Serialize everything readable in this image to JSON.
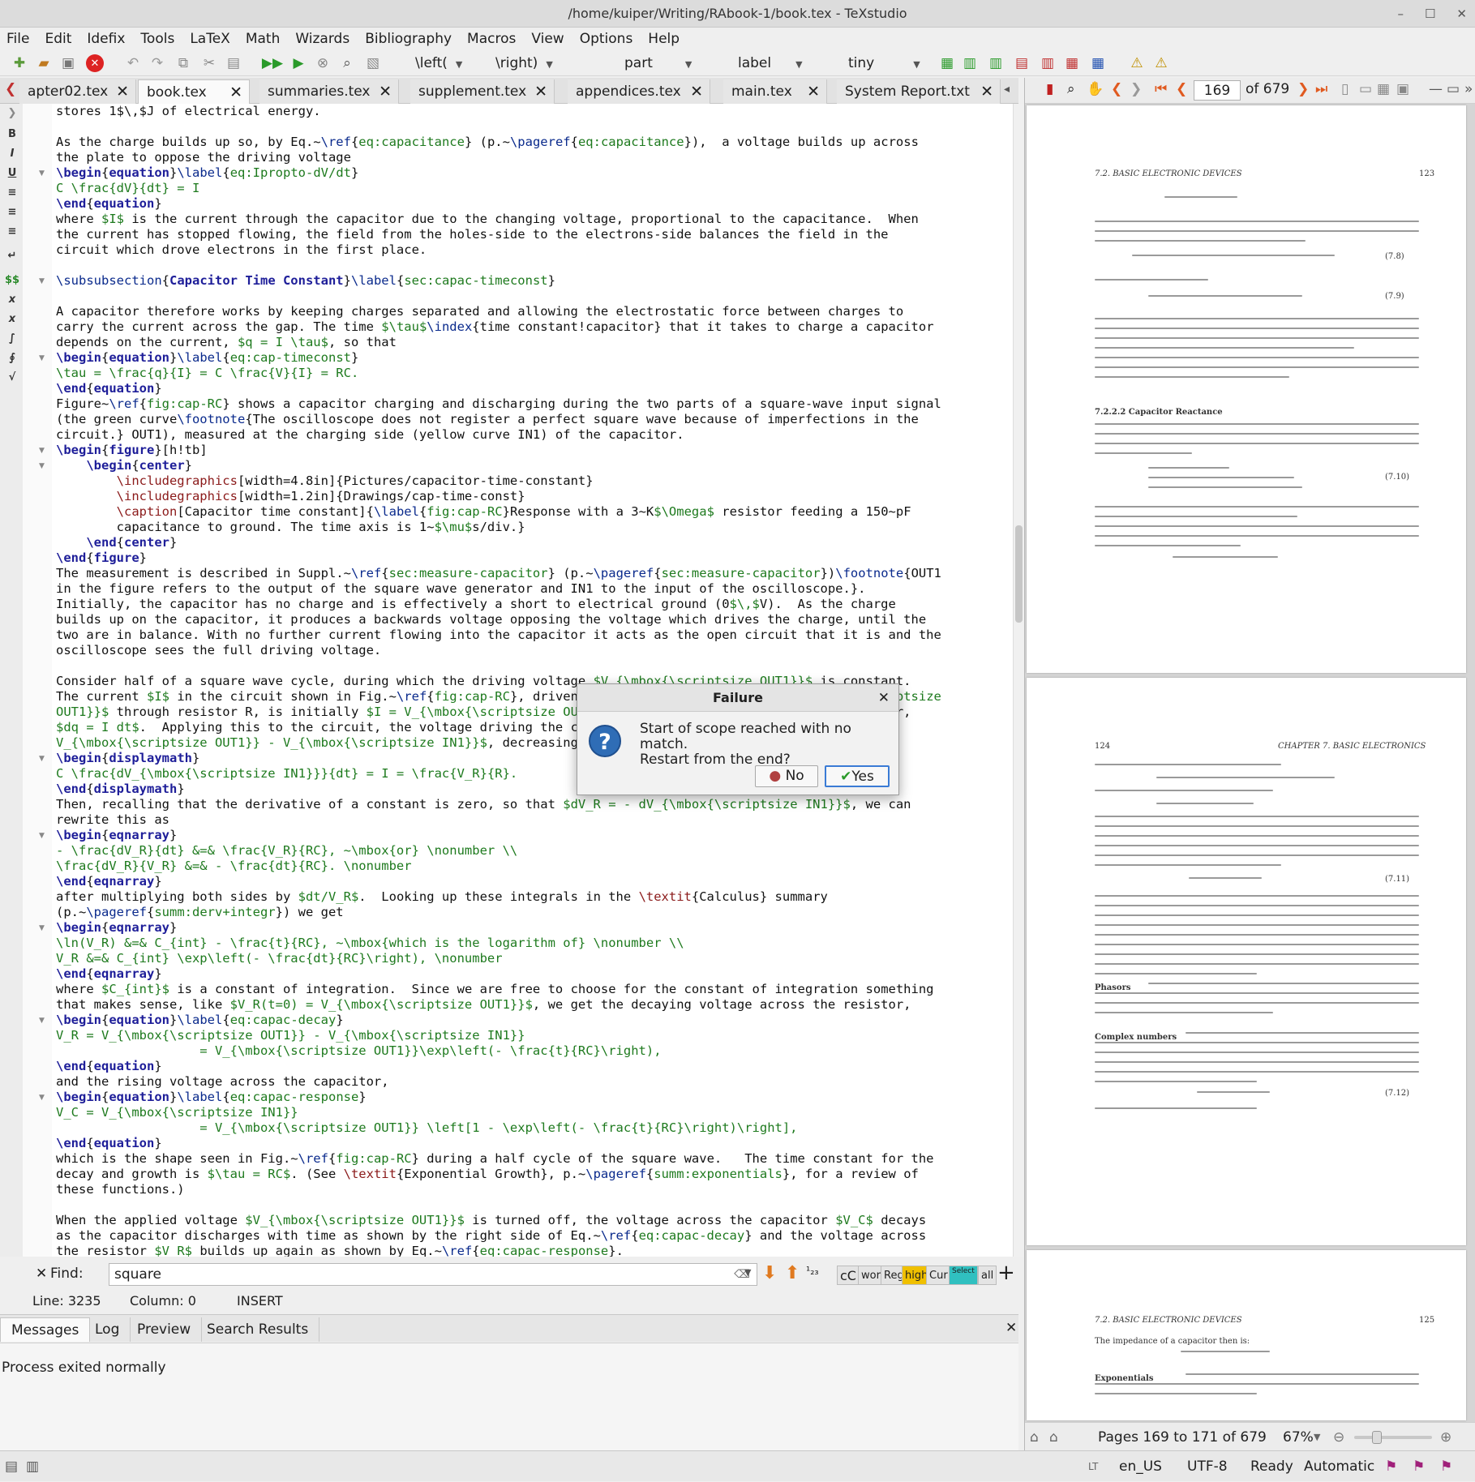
{
  "window": {
    "title": "/home/kuiper/Writing/RAbook-1/book.tex - TeXstudio",
    "controls": [
      "–",
      "☐",
      "✕"
    ]
  },
  "menu": [
    "File",
    "Edit",
    "Idefix",
    "Tools",
    "LaTeX",
    "Math",
    "Wizards",
    "Bibliography",
    "Macros",
    "View",
    "Options",
    "Help"
  ],
  "toolbar": {
    "left": "\\left(",
    "right": "\\right)",
    "part": "part",
    "label": "label",
    "size": "tiny"
  },
  "tabs": [
    {
      "label": "apter02.tex",
      "active": false
    },
    {
      "label": "book.tex",
      "active": true
    },
    {
      "label": "summaries.tex",
      "active": false
    },
    {
      "label": "supplement.tex",
      "active": false
    },
    {
      "label": "appendices.tex",
      "active": false
    },
    {
      "label": "main.tex",
      "active": false
    },
    {
      "label": "System Report.txt",
      "active": false
    }
  ],
  "editor_lines": [
    [
      [
        "t",
        "stores 1$\\,$J of electrical energy."
      ]
    ],
    [
      [
        "t",
        ""
      ]
    ],
    [
      [
        "t",
        "As the charge builds up so, by Eq.~"
      ],
      [
        "b",
        "\\ref"
      ],
      [
        "t",
        "{"
      ],
      [
        "g",
        "eq:capacitance"
      ],
      [
        "t",
        "} (p.~"
      ],
      [
        "b",
        "\\pageref"
      ],
      [
        "t",
        "{"
      ],
      [
        "g",
        "eq:capacitance"
      ],
      [
        "t",
        "}),  a voltage builds up across"
      ]
    ],
    [
      [
        "t",
        "the plate to oppose the driving voltage"
      ]
    ],
    [
      [
        "e",
        "\\begin"
      ],
      [
        "t",
        "{"
      ],
      [
        "e",
        "equation"
      ],
      [
        "t",
        "}"
      ],
      [
        "b",
        "\\label"
      ],
      [
        "t",
        "{"
      ],
      [
        "g",
        "eq:Ipropto-dV/dt"
      ],
      [
        "t",
        "}"
      ]
    ],
    [
      [
        "m",
        "C \\frac{dV}{dt} = I"
      ]
    ],
    [
      [
        "e",
        "\\end"
      ],
      [
        "t",
        "{"
      ],
      [
        "e",
        "equation"
      ],
      [
        "t",
        "}"
      ]
    ],
    [
      [
        "t",
        "where "
      ],
      [
        "m",
        "$I$"
      ],
      [
        "t",
        " is the current through the capacitor due to the changing voltage, proportional to the capacitance.  When"
      ]
    ],
    [
      [
        "t",
        "the current has stopped flowing, the field from the holes-side to the electrons-side balances the field in the"
      ]
    ],
    [
      [
        "t",
        "circuit which drove electrons in the first place."
      ]
    ],
    [
      [
        "t",
        ""
      ]
    ],
    [
      [
        "b",
        "\\subsubsection"
      ],
      [
        "t",
        "{"
      ],
      [
        "k",
        "Capacitor Time Constant"
      ],
      [
        "t",
        "}"
      ],
      [
        "b",
        "\\label"
      ],
      [
        "t",
        "{"
      ],
      [
        "g",
        "sec:capac-timeconst"
      ],
      [
        "t",
        "}"
      ]
    ],
    [
      [
        "t",
        ""
      ]
    ],
    [
      [
        "t",
        "A capacitor therefore works by keeping charges separated and allowing the electrostatic force between charges to"
      ]
    ],
    [
      [
        "t",
        "carry the current across the gap. The time "
      ],
      [
        "m",
        "$\\tau$"
      ],
      [
        "b",
        "\\index"
      ],
      [
        "t",
        "{time constant!capacitor} that it takes to charge a capacitor"
      ]
    ],
    [
      [
        "t",
        "depends on the current, "
      ],
      [
        "m",
        "$q = I \\tau$"
      ],
      [
        "t",
        ", so that"
      ]
    ],
    [
      [
        "e",
        "\\begin"
      ],
      [
        "t",
        "{"
      ],
      [
        "e",
        "equation"
      ],
      [
        "t",
        "}"
      ],
      [
        "b",
        "\\label"
      ],
      [
        "t",
        "{"
      ],
      [
        "g",
        "eq:cap-timeconst"
      ],
      [
        "t",
        "}"
      ]
    ],
    [
      [
        "m",
        "\\tau = \\frac{q}{I} = C \\frac{V}{I} = RC."
      ]
    ],
    [
      [
        "e",
        "\\end"
      ],
      [
        "t",
        "{"
      ],
      [
        "e",
        "equation"
      ],
      [
        "t",
        "}"
      ]
    ],
    [
      [
        "t",
        "Figure~"
      ],
      [
        "b",
        "\\ref"
      ],
      [
        "t",
        "{"
      ],
      [
        "g",
        "fig:cap-RC"
      ],
      [
        "t",
        "} shows a capacitor charging and discharging during the two parts of a square-wave input signal"
      ]
    ],
    [
      [
        "t",
        "(the green curve"
      ],
      [
        "b",
        "\\footnote"
      ],
      [
        "t",
        "{The oscilloscope does not register a perfect square wave because of imperfections in the"
      ]
    ],
    [
      [
        "t",
        "circuit.} OUT1), measured at the charging side (yellow curve IN1) of the capacitor."
      ]
    ],
    [
      [
        "e",
        "\\begin"
      ],
      [
        "t",
        "{"
      ],
      [
        "e",
        "figure"
      ],
      [
        "t",
        "}[h!tb]"
      ]
    ],
    [
      [
        "t",
        "    "
      ],
      [
        "e",
        "\\begin"
      ],
      [
        "t",
        "{"
      ],
      [
        "e",
        "center"
      ],
      [
        "t",
        "}"
      ]
    ],
    [
      [
        "t",
        "        "
      ],
      [
        "a",
        "\\includegraphics"
      ],
      [
        "t",
        "[width=4.8in]{Pictures/capacitor-time-constant}"
      ]
    ],
    [
      [
        "t",
        "        "
      ],
      [
        "a",
        "\\includegraphics"
      ],
      [
        "t",
        "[width=1.2in]{Drawings/cap-time-const}"
      ]
    ],
    [
      [
        "t",
        "        "
      ],
      [
        "a",
        "\\caption"
      ],
      [
        "t",
        "[Capacitor time constant]{"
      ],
      [
        "b",
        "\\label"
      ],
      [
        "t",
        "{"
      ],
      [
        "g",
        "fig:cap-RC"
      ],
      [
        "t",
        "}Response with a 3~K"
      ],
      [
        "m",
        "$\\Omega$"
      ],
      [
        "t",
        " resistor feeding a 150~pF"
      ]
    ],
    [
      [
        "t",
        "        capacitance to ground. The time axis is 1~"
      ],
      [
        "m",
        "$\\mu$"
      ],
      [
        "t",
        "s/div.}"
      ]
    ],
    [
      [
        "t",
        "    "
      ],
      [
        "e",
        "\\end"
      ],
      [
        "t",
        "{"
      ],
      [
        "e",
        "center"
      ],
      [
        "t",
        "}"
      ]
    ],
    [
      [
        "e",
        "\\end"
      ],
      [
        "t",
        "{"
      ],
      [
        "e",
        "figure"
      ],
      [
        "t",
        "}"
      ]
    ],
    [
      [
        "t",
        "The measurement is described in Suppl.~"
      ],
      [
        "b",
        "\\ref"
      ],
      [
        "t",
        "{"
      ],
      [
        "g",
        "sec:measure-capacitor"
      ],
      [
        "t",
        "} (p.~"
      ],
      [
        "b",
        "\\pageref"
      ],
      [
        "t",
        "{"
      ],
      [
        "g",
        "sec:measure-capacitor"
      ],
      [
        "t",
        "})"
      ],
      [
        "b",
        "\\footnote"
      ],
      [
        "t",
        "{OUT1"
      ]
    ],
    [
      [
        "t",
        "in the figure refers to the output of the square wave generator and IN1 to the input of the oscilloscope.}."
      ]
    ],
    [
      [
        "t",
        "Initially, the capacitor has no charge and is effectively a short to electrical ground (0"
      ],
      [
        "m",
        "$\\,$"
      ],
      [
        "t",
        "V).  As the charge"
      ]
    ],
    [
      [
        "t",
        "builds up on the capacitor, it produces a backwards voltage opposing the voltage which drives the charge, until the"
      ]
    ],
    [
      [
        "t",
        "two are in balance. With no further current flowing into the capacitor it acts as the open circuit that it is and the"
      ]
    ],
    [
      [
        "t",
        "oscilloscope sees the full driving voltage."
      ]
    ],
    [
      [
        "t",
        ""
      ]
    ],
    [
      [
        "t",
        "Consider half of a square wave cycle, during which the driving voltage "
      ],
      [
        "m",
        "$V_{\\mbox{\\scriptsize OUT1}}$"
      ],
      [
        "t",
        " is constant."
      ]
    ],
    [
      [
        "t",
        "The current "
      ],
      [
        "m",
        "$I$"
      ],
      [
        "t",
        " in the circuit shown in Fig.~"
      ],
      [
        "b",
        "\\ref"
      ],
      [
        "t",
        "{"
      ],
      [
        "g",
        "fig:cap-RC"
      ],
      [
        "t",
        "}, driven by the voltage difference "
      ],
      [
        "m",
        "$V_{\\mbox{\\scriptsize"
      ]
    ],
    [
      [
        "m",
        "OUT1}}$"
      ],
      [
        "t",
        " through resistor R, is initially "
      ],
      [
        "m",
        "$I = V_{\\mbox{\\scriptsize OUT1}}/R$"
      ],
      [
        "t",
        ". As charge flows into the capacitor,"
      ]
    ],
    [
      [
        "m",
        "$dq = I dt$"
      ],
      [
        "t",
        ".  Applying this to the circuit, the voltage driving the current is the difference"
      ]
    ],
    [
      [
        "m",
        "V_{\\mbox{\\scriptsize OUT1}} - V_{\\mbox{\\scriptsize IN1}}$"
      ],
      [
        "t",
        ", decreasing with time."
      ]
    ],
    [
      [
        "e",
        "\\begin"
      ],
      [
        "t",
        "{"
      ],
      [
        "e",
        "displaymath"
      ],
      [
        "t",
        "}"
      ]
    ],
    [
      [
        "m",
        "C \\frac{dV_{\\mbox{\\scriptsize IN1}}}{dt} = I = \\frac{V_R}{R}."
      ]
    ],
    [
      [
        "e",
        "\\end"
      ],
      [
        "t",
        "{"
      ],
      [
        "e",
        "displaymath"
      ],
      [
        "t",
        "}"
      ]
    ],
    [
      [
        "t",
        "Then, recalling that the derivative of a constant is zero, so that "
      ],
      [
        "m",
        "$dV_R = - dV_{\\mbox{\\scriptsize IN1}}$"
      ],
      [
        "t",
        ", we can"
      ]
    ],
    [
      [
        "t",
        "rewrite this as"
      ]
    ],
    [
      [
        "e",
        "\\begin"
      ],
      [
        "t",
        "{"
      ],
      [
        "e",
        "eqnarray"
      ],
      [
        "t",
        "}"
      ]
    ],
    [
      [
        "m",
        "- \\frac{dV_R}{dt} &=& \\frac{V_R}{RC}, ~\\mbox{or} \\nonumber \\\\"
      ]
    ],
    [
      [
        "m",
        "\\frac{dV_R}{V_R} &=& - \\frac{dt}{RC}. \\nonumber"
      ]
    ],
    [
      [
        "e",
        "\\end"
      ],
      [
        "t",
        "{"
      ],
      [
        "e",
        "eqnarray"
      ],
      [
        "t",
        "}"
      ]
    ],
    [
      [
        "t",
        "after multiplying both sides by "
      ],
      [
        "m",
        "$dt/V_R$"
      ],
      [
        "t",
        ".  Looking up these integrals in the "
      ],
      [
        "a",
        "\\textit"
      ],
      [
        "t",
        "{Calculus} summary"
      ]
    ],
    [
      [
        "t",
        "(p.~"
      ],
      [
        "b",
        "\\pageref"
      ],
      [
        "t",
        "{"
      ],
      [
        "g",
        "summ:derv+integr"
      ],
      [
        "t",
        "}) we get"
      ]
    ],
    [
      [
        "e",
        "\\begin"
      ],
      [
        "t",
        "{"
      ],
      [
        "e",
        "eqnarray"
      ],
      [
        "t",
        "}"
      ]
    ],
    [
      [
        "m",
        "\\ln(V_R) &=& C_{int} - \\frac{t}{RC}, ~\\mbox{which is the logarithm of} \\nonumber \\\\"
      ]
    ],
    [
      [
        "m",
        "V_R &=& C_{int} \\exp\\left(- \\frac{dt}{RC}\\right), \\nonumber"
      ]
    ],
    [
      [
        "e",
        "\\end"
      ],
      [
        "t",
        "{"
      ],
      [
        "e",
        "eqnarray"
      ],
      [
        "t",
        "}"
      ]
    ],
    [
      [
        "t",
        "where "
      ],
      [
        "m",
        "$C_{int}$"
      ],
      [
        "t",
        " is a constant of integration.  Since we are free to choose for the constant of integration something"
      ]
    ],
    [
      [
        "t",
        "that makes sense, like "
      ],
      [
        "m",
        "$V_R(t=0) = V_{\\mbox{\\scriptsize OUT1}}$"
      ],
      [
        "t",
        ", we get the decaying voltage across the resistor,"
      ]
    ],
    [
      [
        "e",
        "\\begin"
      ],
      [
        "t",
        "{"
      ],
      [
        "e",
        "equation"
      ],
      [
        "t",
        "}"
      ],
      [
        "b",
        "\\label"
      ],
      [
        "t",
        "{"
      ],
      [
        "g",
        "eq:capac-decay"
      ],
      [
        "t",
        "}"
      ]
    ],
    [
      [
        "m",
        "V_R = V_{\\mbox{\\scriptsize OUT1}} - V_{\\mbox{\\scriptsize IN1}}"
      ]
    ],
    [
      [
        "m",
        "                   = V_{\\mbox{\\scriptsize OUT1}}\\exp\\left(- \\frac{t}{RC}\\right),"
      ]
    ],
    [
      [
        "e",
        "\\end"
      ],
      [
        "t",
        "{"
      ],
      [
        "e",
        "equation"
      ],
      [
        "t",
        "}"
      ]
    ],
    [
      [
        "t",
        "and the rising voltage across the capacitor,"
      ]
    ],
    [
      [
        "e",
        "\\begin"
      ],
      [
        "t",
        "{"
      ],
      [
        "e",
        "equation"
      ],
      [
        "t",
        "}"
      ],
      [
        "b",
        "\\label"
      ],
      [
        "t",
        "{"
      ],
      [
        "g",
        "eq:capac-response"
      ],
      [
        "t",
        "}"
      ]
    ],
    [
      [
        "m",
        "V_C = V_{\\mbox{\\scriptsize IN1}}"
      ]
    ],
    [
      [
        "m",
        "                   = V_{\\mbox{\\scriptsize OUT1}} \\left[1 - \\exp\\left(- \\frac{t}{RC}\\right)\\right],"
      ]
    ],
    [
      [
        "e",
        "\\end"
      ],
      [
        "t",
        "{"
      ],
      [
        "e",
        "equation"
      ],
      [
        "t",
        "}"
      ]
    ],
    [
      [
        "t",
        "which is the shape seen in Fig.~"
      ],
      [
        "b",
        "\\ref"
      ],
      [
        "t",
        "{"
      ],
      [
        "g",
        "fig:cap-RC"
      ],
      [
        "t",
        "} during a half cycle of the square wave.   The time constant for the"
      ]
    ],
    [
      [
        "t",
        "decay and growth is "
      ],
      [
        "m",
        "$\\tau = RC$"
      ],
      [
        "t",
        ". (See "
      ],
      [
        "a",
        "\\textit"
      ],
      [
        "t",
        "{Exponential Growth}, p.~"
      ],
      [
        "b",
        "\\pageref"
      ],
      [
        "t",
        "{"
      ],
      [
        "g",
        "summ:exponentials"
      ],
      [
        "t",
        "}, for a review of"
      ]
    ],
    [
      [
        "t",
        "these functions.)"
      ]
    ],
    [
      [
        "t",
        ""
      ]
    ],
    [
      [
        "t",
        "When the applied voltage "
      ],
      [
        "m",
        "$V_{\\mbox{\\scriptsize OUT1}}$"
      ],
      [
        "t",
        " is turned off, the voltage across the capacitor "
      ],
      [
        "m",
        "$V_C$"
      ],
      [
        "t",
        " decays"
      ]
    ],
    [
      [
        "t",
        "as the capacitor discharges with time as shown by the right side of Eq.~"
      ],
      [
        "b",
        "\\ref"
      ],
      [
        "t",
        "{"
      ],
      [
        "g",
        "eq:capac-decay"
      ],
      [
        "t",
        "} and the voltage across"
      ]
    ],
    [
      [
        "t",
        "the resistor "
      ],
      [
        "m",
        "$V_R$"
      ],
      [
        "t",
        " builds up again as shown by Eq.~"
      ],
      [
        "b",
        "\\ref"
      ],
      [
        "t",
        "{"
      ],
      [
        "g",
        "eq:capac-response"
      ],
      [
        "t",
        "}."
      ]
    ]
  ],
  "find": {
    "label": "Find:",
    "value": "square",
    "buttons": [
      "cC",
      "word",
      "Reg",
      "high",
      "Cur",
      "Select",
      "all"
    ]
  },
  "status": {
    "line": "Line: 3235",
    "column": "Column: 0",
    "mode": "INSERT"
  },
  "messages": {
    "tabs": [
      "Messages",
      "Log",
      "Preview",
      "Search Results"
    ],
    "text": "Process exited normally"
  },
  "pdf": {
    "page": "169",
    "of": "of 679",
    "range": "Pages 169 to 171 of 679",
    "zoom": "67%",
    "p1": {
      "header_left": "7.2.  BASIC ELECTRONIC DEVICES",
      "header_right": "123",
      "section": "7.2.2.2   Capacitor Reactance",
      "eqn": [
        "(7.8)",
        "(7.9)",
        "(7.10)"
      ]
    },
    "p2": {
      "header_left": "124",
      "header_right": "CHAPTER 7.  BASIC ELECTRONICS",
      "phasors": "Phasors",
      "complex": "Complex numbers",
      "eqn": [
        "(7.11)",
        "(7.12)"
      ]
    },
    "p3": {
      "header_left": "7.2.  BASIC ELECTRONIC DEVICES",
      "header_right": "125",
      "text": "The impedance of a capacitor then is:",
      "exp": "Exponentials"
    }
  },
  "bottom": {
    "lt": "LT",
    "lang": "en_US",
    "enc": "UTF-8",
    "ready": "Ready",
    "auto": "Automatic"
  },
  "dialog": {
    "title": "Failure",
    "line1": "Start of scope reached with no match.",
    "line2": "Restart from the end?",
    "no": "No",
    "yes": "Yes"
  }
}
